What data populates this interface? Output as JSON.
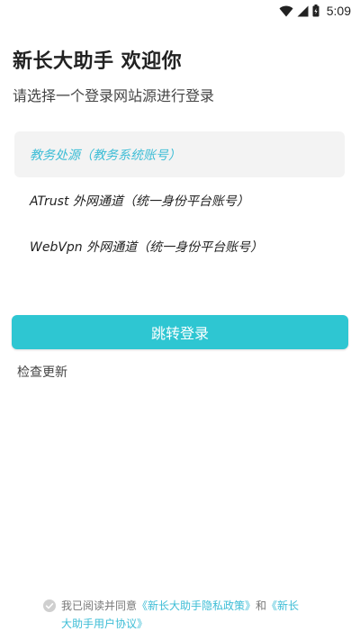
{
  "status_bar": {
    "time": "5:09",
    "icons": [
      "wifi-icon",
      "cellular-signal-icon",
      "battery-icon"
    ]
  },
  "header": {
    "title": "新长大助手 欢迎你",
    "subtitle": "请选择一个登录网站源进行登录"
  },
  "sources": [
    {
      "label": "教务处源（教务系统账号）",
      "selected": true
    },
    {
      "label": "ATrust 外网通道（统一身份平台账号）",
      "selected": false
    },
    {
      "label": "WebVpn 外网通道（统一身份平台账号）",
      "selected": false
    }
  ],
  "actions": {
    "login_label": "跳转登录",
    "check_update_label": "检查更新"
  },
  "agreement": {
    "prefix": "我已阅读并同意",
    "privacy_link": "《新长大助手隐私政策》",
    "conjunction": "和",
    "user_agreement_link": "《新长大助手用户协议》"
  },
  "colors": {
    "accent": "#2ec6d2",
    "link": "#3dbdd6",
    "selected_bg": "#f3f3f3"
  }
}
